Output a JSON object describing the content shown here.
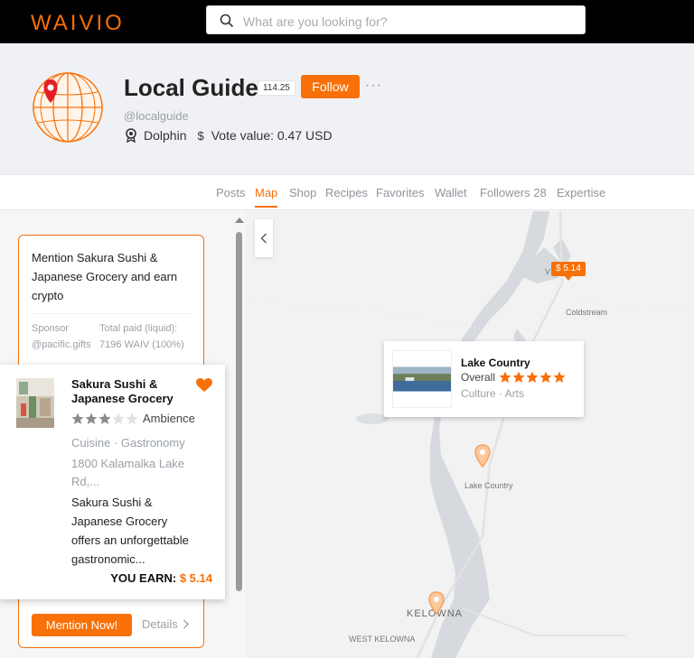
{
  "topbar": {
    "logo": "WAIVIO",
    "search_placeholder": "What are you looking for?"
  },
  "profile": {
    "name": "Local Guide",
    "reputation": "114.25",
    "follow_label": "Follow",
    "more_label": "···",
    "handle": "@localguide",
    "rank": "Dolphin",
    "vote_value": "Vote value: 0.47 USD"
  },
  "tabs": [
    {
      "label": "Posts",
      "active": false
    },
    {
      "label": "Map",
      "active": true
    },
    {
      "label": "Shop",
      "active": false
    },
    {
      "label": "Recipes",
      "active": false
    },
    {
      "label": "Favorites",
      "active": false
    },
    {
      "label": "Wallet",
      "active": false
    },
    {
      "label": "Followers 28",
      "active": false
    },
    {
      "label": "Expertise",
      "active": false
    }
  ],
  "campaign": {
    "title": "Mention Sakura Sushi & Japanese Grocery and earn crypto",
    "sponsor_label": "Sponsor",
    "sponsor_value": "@pacific.gifts",
    "paid_label": "Total paid (liquid):",
    "paid_value": "7196 WAIV (100%)",
    "mention_label": "Mention Now!",
    "details_label": "Details"
  },
  "object_card": {
    "name": "Sakura Sushi & Japanese Grocery",
    "rating": 3,
    "rating_max": 5,
    "rating_label": "Ambience",
    "category": "Cuisine · Gastronomy",
    "address": "1800 Kalamalka Lake Rd,...",
    "description": "Sakura Sushi & Japanese Grocery offers an unforgettable gastronomic...",
    "earn_label": "YOU EARN:",
    "earn_value": "$ 5.14"
  },
  "map": {
    "price_pin": "$ 5.14",
    "labels": {
      "coldstream": "Coldstream",
      "lake_country": "Lake Country",
      "kelowna": "KELOWNA",
      "west_kelowna": "WEST KELOWNA",
      "v_label": "V"
    },
    "popup": {
      "title": "Lake Country",
      "overall_label": "Overall",
      "rating": 5,
      "category": "Culture · Arts"
    }
  },
  "colors": {
    "accent": "#f87007",
    "topbar": "#000000",
    "water": "#d4d8dd",
    "land": "#f2f2f2"
  }
}
